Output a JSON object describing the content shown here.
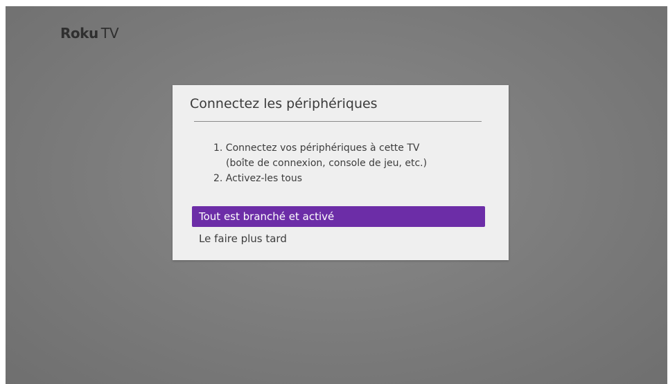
{
  "logo": {
    "brand": "Roku",
    "suffix": "TV"
  },
  "dialog": {
    "title": "Connectez les périphériques",
    "steps": [
      "1. Connectez vos périphériques à cette TV",
      "(boîte de connexion, console de jeu, etc.)",
      "2. Activez-les tous"
    ],
    "options": [
      "Tout est branché et activé",
      "Le faire plus tard"
    ],
    "selected_option_index": 0
  },
  "colors": {
    "background": "#7b7b7b",
    "dialog": "#efefef",
    "highlight": "#6c2da7",
    "text": "#3c3c3c"
  }
}
